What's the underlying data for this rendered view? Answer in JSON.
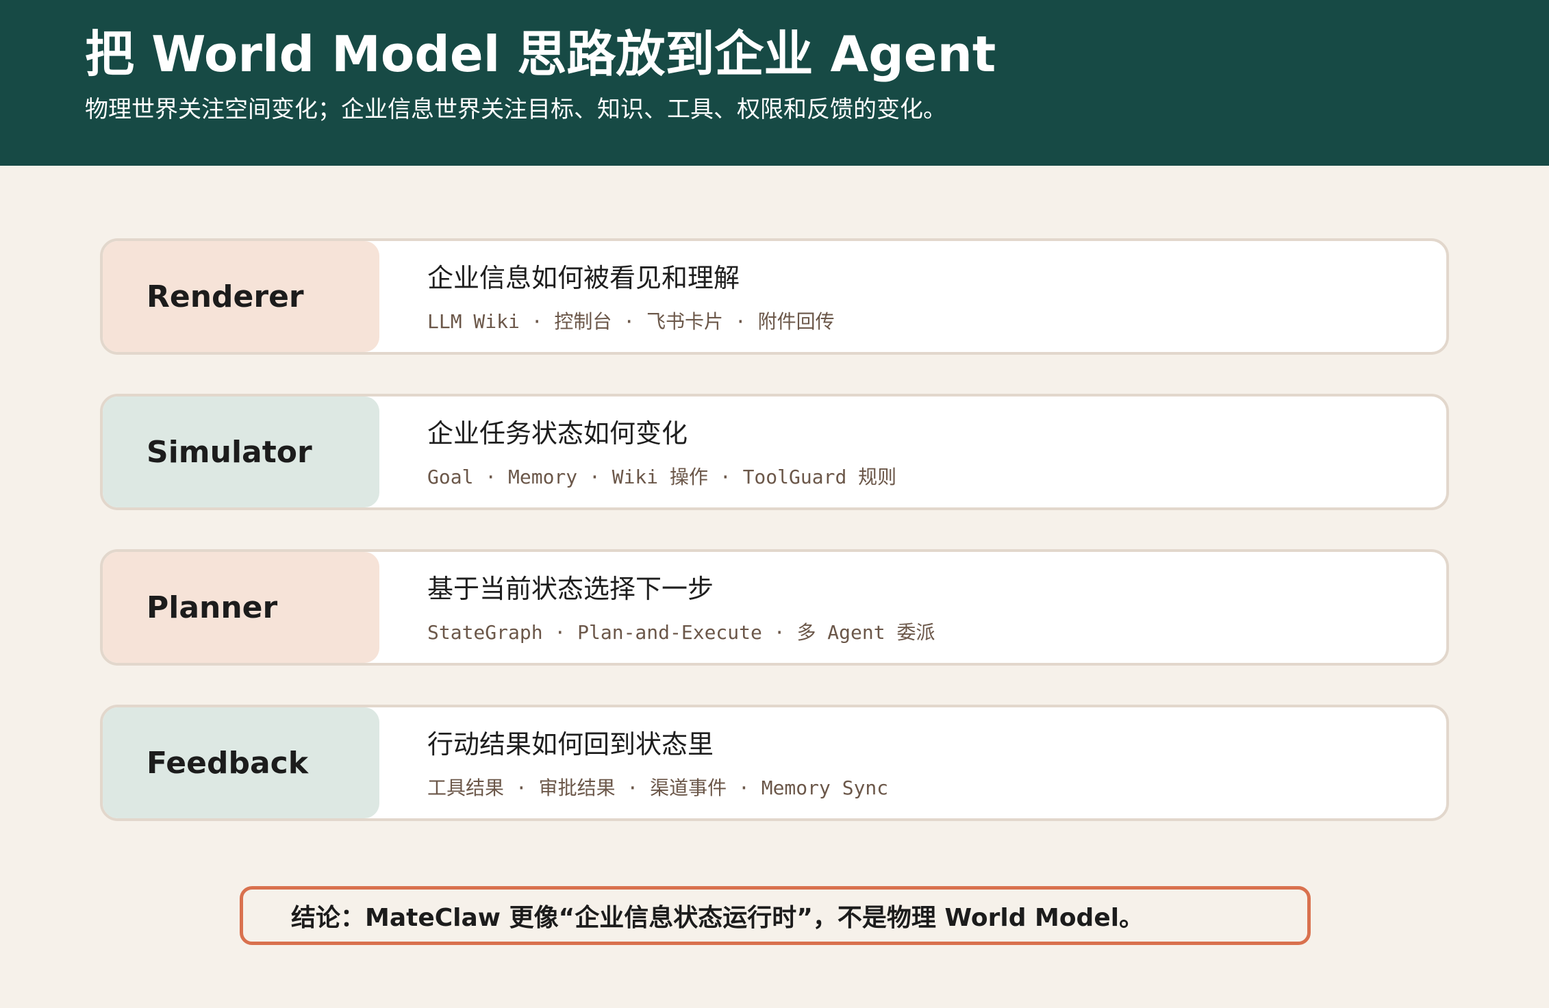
{
  "header": {
    "title": "把 World Model 思路放到企业 Agent",
    "subtitle": "物理世界关注空间变化；企业信息世界关注目标、知识、工具、权限和反馈的变化。"
  },
  "rows": [
    {
      "label": "Renderer",
      "title": "企业信息如何被看见和理解",
      "tags": "LLM Wiki · 控制台 · 飞书卡片 · 附件回传"
    },
    {
      "label": "Simulator",
      "title": "企业任务状态如何变化",
      "tags": "Goal · Memory · Wiki 操作 · ToolGuard 规则"
    },
    {
      "label": "Planner",
      "title": "基于当前状态选择下一步",
      "tags": "StateGraph · Plan-and-Execute · 多 Agent 委派"
    },
    {
      "label": "Feedback",
      "title": "行动结果如何回到状态里",
      "tags": "工具结果 · 审批结果 · 渠道事件 · Memory Sync"
    }
  ],
  "conclusion": "结论：MateClaw 更像“企业信息状态运行时”，不是物理 World Model。",
  "colors": {
    "header_bg": "#174a45",
    "page_bg": "#f6f1ea",
    "peach": "#f6e3d8",
    "mint": "#dde8e3",
    "accent_border": "#d9714e"
  }
}
